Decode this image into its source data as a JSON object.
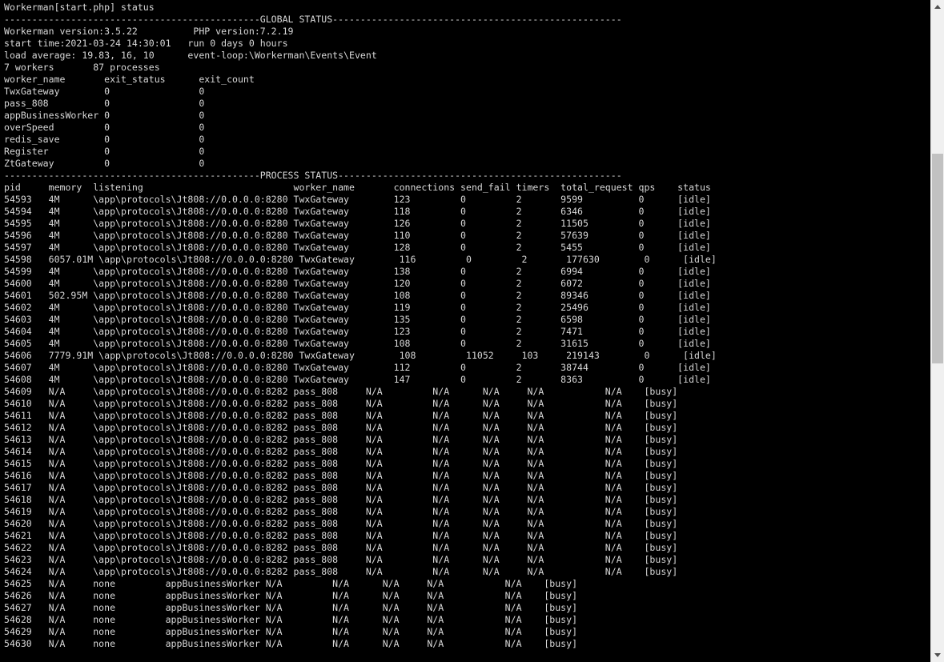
{
  "terminal": {
    "lines": [
      "Workerman[start.php] status",
      "----------------------------------------------GLOBAL STATUS----------------------------------------------------",
      "Workerman version:3.5.22          PHP version:7.2.19",
      "start time:2021-03-24 14:30:01   run 0 days 0 hours",
      "load average: 19.83, 16, 10      event-loop:\\Workerman\\Events\\Event",
      "7 workers       87 processes",
      "worker_name       exit_status      exit_count",
      "TwxGateway        0                0",
      "pass_808          0                0",
      "appBusinessWorker 0                0",
      "overSpeed         0                0",
      "redis_save        0                0",
      "Register          0                0",
      "ZtGateway         0                0",
      "----------------------------------------------PROCESS STATUS---------------------------------------------------",
      "pid     memory  listening                           worker_name       connections send_fail timers  total_request qps    status",
      "54593   4M      \\app\\protocols\\Jt808://0.0.0.0:8280 TwxGateway        123         0         2       9599          0      [idle]",
      "54594   4M      \\app\\protocols\\Jt808://0.0.0.0:8280 TwxGateway        118         0         2       6346          0      [idle]",
      "54595   4M      \\app\\protocols\\Jt808://0.0.0.0:8280 TwxGateway        126         0         2       11505         0      [idle]",
      "54596   4M      \\app\\protocols\\Jt808://0.0.0.0:8280 TwxGateway        110         0         2       57639         0      [idle]",
      "54597   4M      \\app\\protocols\\Jt808://0.0.0.0:8280 TwxGateway        128         0         2       5455          0      [idle]",
      "54598   6057.01M \\app\\protocols\\Jt808://0.0.0.0:8280 TwxGateway        116         0         2       177630        0      [idle]",
      "54599   4M      \\app\\protocols\\Jt808://0.0.0.0:8280 TwxGateway        138         0         2       6994          0      [idle]",
      "54600   4M      \\app\\protocols\\Jt808://0.0.0.0:8280 TwxGateway        120         0         2       6072          0      [idle]",
      "54601   502.95M \\app\\protocols\\Jt808://0.0.0.0:8280 TwxGateway        108         0         2       89346         0      [idle]",
      "54602   4M      \\app\\protocols\\Jt808://0.0.0.0:8280 TwxGateway        119         0         2       25496         0      [idle]",
      "54603   4M      \\app\\protocols\\Jt808://0.0.0.0:8280 TwxGateway        135         0         2       6598          0      [idle]",
      "54604   4M      \\app\\protocols\\Jt808://0.0.0.0:8280 TwxGateway        123         0         2       7471          0      [idle]",
      "54605   4M      \\app\\protocols\\Jt808://0.0.0.0:8280 TwxGateway        108         0         2       31615         0      [idle]",
      "54606   7779.91M \\app\\protocols\\Jt808://0.0.0.0:8280 TwxGateway        108         11052     103     219143        0      [idle]",
      "54607   4M      \\app\\protocols\\Jt808://0.0.0.0:8280 TwxGateway        112         0         2       38744         0      [idle]",
      "54608   4M      \\app\\protocols\\Jt808://0.0.0.0:8280 TwxGateway        147         0         2       8363          0      [idle]",
      "54609   N/A     \\app\\protocols\\Jt808://0.0.0.0:8282 pass_808     N/A         N/A      N/A     N/A           N/A    [busy]",
      "54610   N/A     \\app\\protocols\\Jt808://0.0.0.0:8282 pass_808     N/A         N/A      N/A     N/A           N/A    [busy]",
      "54611   N/A     \\app\\protocols\\Jt808://0.0.0.0:8282 pass_808     N/A         N/A      N/A     N/A           N/A    [busy]",
      "54612   N/A     \\app\\protocols\\Jt808://0.0.0.0:8282 pass_808     N/A         N/A      N/A     N/A           N/A    [busy]",
      "54613   N/A     \\app\\protocols\\Jt808://0.0.0.0:8282 pass_808     N/A         N/A      N/A     N/A           N/A    [busy]",
      "54614   N/A     \\app\\protocols\\Jt808://0.0.0.0:8282 pass_808     N/A         N/A      N/A     N/A           N/A    [busy]",
      "54615   N/A     \\app\\protocols\\Jt808://0.0.0.0:8282 pass_808     N/A         N/A      N/A     N/A           N/A    [busy]",
      "54616   N/A     \\app\\protocols\\Jt808://0.0.0.0:8282 pass_808     N/A         N/A      N/A     N/A           N/A    [busy]",
      "54617   N/A     \\app\\protocols\\Jt808://0.0.0.0:8282 pass_808     N/A         N/A      N/A     N/A           N/A    [busy]",
      "54618   N/A     \\app\\protocols\\Jt808://0.0.0.0:8282 pass_808     N/A         N/A      N/A     N/A           N/A    [busy]",
      "54619   N/A     \\app\\protocols\\Jt808://0.0.0.0:8282 pass_808     N/A         N/A      N/A     N/A           N/A    [busy]",
      "54620   N/A     \\app\\protocols\\Jt808://0.0.0.0:8282 pass_808     N/A         N/A      N/A     N/A           N/A    [busy]",
      "54621   N/A     \\app\\protocols\\Jt808://0.0.0.0:8282 pass_808     N/A         N/A      N/A     N/A           N/A    [busy]",
      "54622   N/A     \\app\\protocols\\Jt808://0.0.0.0:8282 pass_808     N/A         N/A      N/A     N/A           N/A    [busy]",
      "54623   N/A     \\app\\protocols\\Jt808://0.0.0.0:8282 pass_808     N/A         N/A      N/A     N/A           N/A    [busy]",
      "54624   N/A     \\app\\protocols\\Jt808://0.0.0.0:8282 pass_808     N/A         N/A      N/A     N/A           N/A    [busy]",
      "54625   N/A     none         appBusinessWorker N/A         N/A      N/A     N/A           N/A    [busy]",
      "54626   N/A     none         appBusinessWorker N/A         N/A      N/A     N/A           N/A    [busy]",
      "54627   N/A     none         appBusinessWorker N/A         N/A      N/A     N/A           N/A    [busy]",
      "54628   N/A     none         appBusinessWorker N/A         N/A      N/A     N/A           N/A    [busy]",
      "54629   N/A     none         appBusinessWorker N/A         N/A      N/A     N/A           N/A    [busy]",
      "54630   N/A     none         appBusinessWorker N/A         N/A      N/A     N/A           N/A    [busy]"
    ]
  },
  "scrollbar": {
    "up_icon": "chevron-up-icon",
    "down_icon": "chevron-down-icon",
    "position": 0.33
  },
  "colors": {
    "background": "#000000",
    "foreground": "#d9d9d9",
    "scrollbar_track": "#f0f0f0",
    "scrollbar_thumb": "#c1c1c1"
  }
}
